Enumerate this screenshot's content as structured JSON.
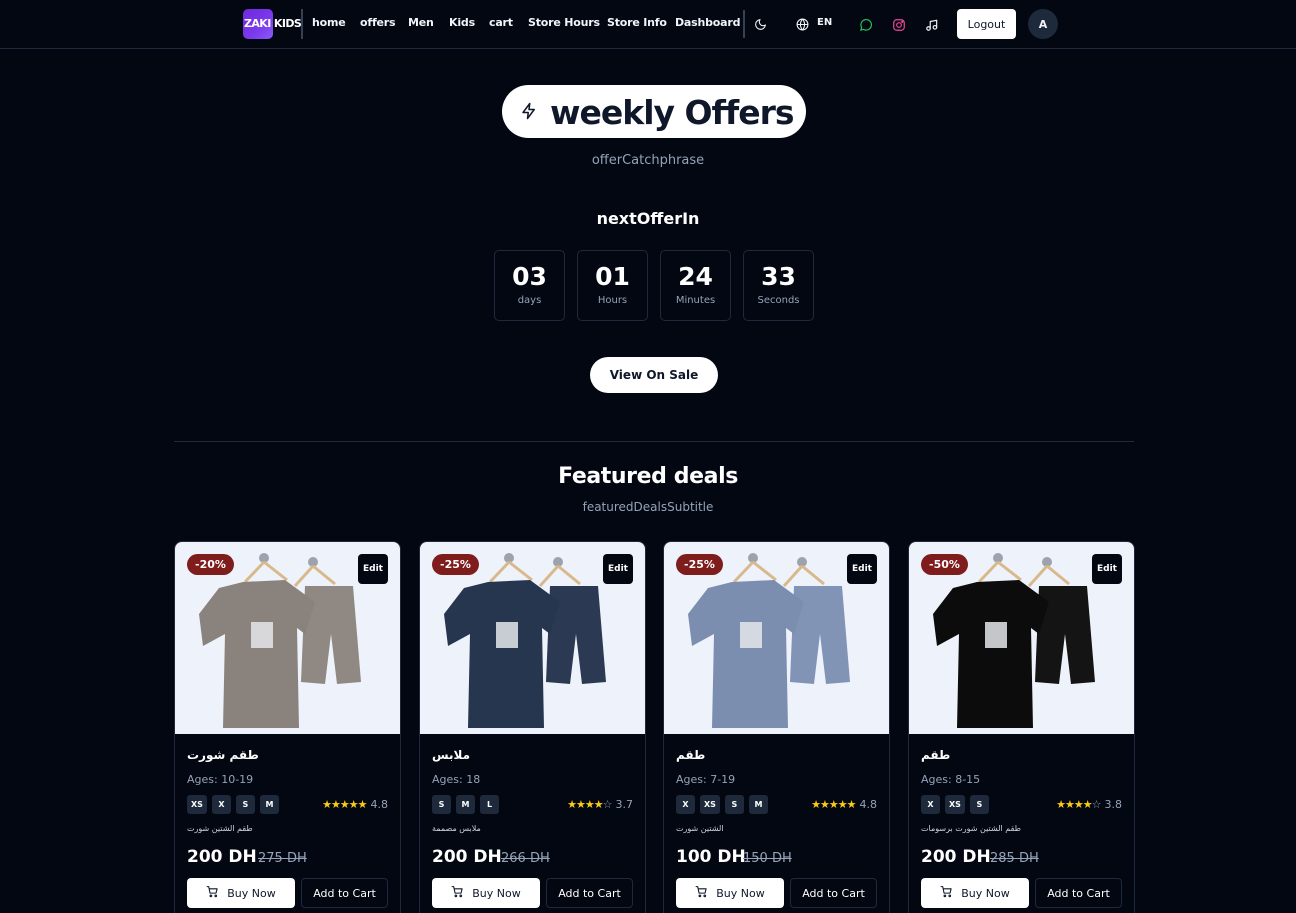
{
  "nav": {
    "logo_text": "ZAKI KIDS",
    "links": [
      "home",
      "offers",
      "Men",
      "Kids",
      "cart",
      "Store Hours",
      "Store Info",
      "Dashboard"
    ],
    "language": "EN",
    "logout_label": "Logout",
    "avatar_initial": "A"
  },
  "hero": {
    "title": "weekly Offers",
    "catchphrase": "offerCatchphrase",
    "next_offer_label": "nextOfferIn",
    "countdown": [
      {
        "value": "03",
        "label": "days"
      },
      {
        "value": "01",
        "label": "Hours"
      },
      {
        "value": "24",
        "label": "Minutes"
      },
      {
        "value": "33",
        "label": "Seconds"
      }
    ],
    "cta_label": "View On Sale"
  },
  "featured": {
    "title": "Featured deals",
    "subtitle": "featuredDealsSubtitle",
    "products": [
      {
        "discount": "-20%",
        "edit_label": "Edit",
        "name": "طقم شورت",
        "ages": "Ages: 10-19",
        "sizes": [
          "XS",
          "X",
          "S",
          "M"
        ],
        "stars": 5,
        "rating": "4.8",
        "description": "طقم الشتين شورت",
        "price": "200 DH",
        "old_price": "275 DH",
        "buy_label": "Buy Now",
        "cart_label": "Add to Cart",
        "shirt_color": "#8a827c",
        "shorts_color": "#8f8883"
      },
      {
        "discount": "-25%",
        "edit_label": "Edit",
        "name": "ملابس",
        "ages": "Ages: 18",
        "sizes": [
          "S",
          "M",
          "L"
        ],
        "stars": 4,
        "rating": "3.7",
        "description": "ملابس مصممة",
        "price": "200 DH",
        "old_price": "266 DH",
        "buy_label": "Buy Now",
        "cart_label": "Add to Cart",
        "shirt_color": "#27364f",
        "shorts_color": "#2b3a52"
      },
      {
        "discount": "-25%",
        "edit_label": "Edit",
        "name": "طقم",
        "ages": "Ages: 7-19",
        "sizes": [
          "X",
          "XS",
          "S",
          "M"
        ],
        "stars": 5,
        "rating": "4.8",
        "description": "الشتين شورت",
        "price": "100 DH",
        "old_price": "150 DH",
        "buy_label": "Buy Now",
        "cart_label": "Add to Cart",
        "shirt_color": "#7c8eb0",
        "shorts_color": "#8194b6"
      },
      {
        "discount": "-50%",
        "edit_label": "Edit",
        "name": "طقم",
        "ages": "Ages: 8-15",
        "sizes": [
          "X",
          "XS",
          "S"
        ],
        "stars": 4,
        "rating": "3.8",
        "description": "طقم الشتين شورت برسومات",
        "price": "200 DH",
        "old_price": "285 DH",
        "buy_label": "Buy Now",
        "cart_label": "Add to Cart",
        "shirt_color": "#0c0c0c",
        "shorts_color": "#141414"
      }
    ]
  }
}
